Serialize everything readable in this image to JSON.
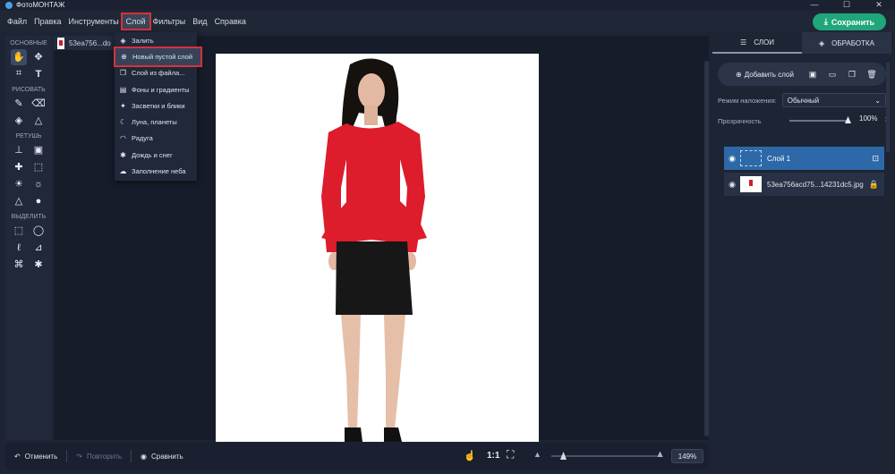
{
  "window": {
    "title": "ФотоМОНТАЖ",
    "minimize": "—",
    "maximize": "☐",
    "close": "✕"
  },
  "menu": [
    "Файл",
    "Правка",
    "Инструменты",
    "Слой",
    "Фильтры",
    "Вид",
    "Справка"
  ],
  "save_button": "Сохранить",
  "toolbar": {
    "groups": [
      "ОСНОВНЫЕ",
      "РИСОВАТЬ",
      "РЕТУШЬ",
      "ВЫДЕЛИТЬ"
    ]
  },
  "document_tab": "53ea756...do",
  "layer_menu": [
    {
      "label": "Залить",
      "icon": "fill-icon"
    },
    {
      "label": "Новый пустой слой",
      "icon": "add-circle-icon"
    },
    {
      "label": "Слой из файла...",
      "icon": "file-layer-icon"
    },
    {
      "label": "Фоны и градиенты",
      "icon": "background-icon"
    },
    {
      "label": "Засветки и блики",
      "icon": "sparkle-icon"
    },
    {
      "label": "Луна, планеты",
      "icon": "moon-icon"
    },
    {
      "label": "Радуга",
      "icon": "rainbow-icon"
    },
    {
      "label": "Дождь и снег",
      "icon": "snow-icon"
    },
    {
      "label": "Заполнение неба",
      "icon": "cloud-icon"
    }
  ],
  "bottom": {
    "undo": "Отменить",
    "redo": "Повторить",
    "compare": "Сравнить",
    "ratio": "1:1",
    "zoom": "149%",
    "zoom_level": 0.1
  },
  "right_panel": {
    "tab_layers": "СЛОИ",
    "tab_processing": "ОБРАБОТКА",
    "add_layer": "Добавить слой",
    "blend_label": "Режим наложения:",
    "blend_value": "Обычный",
    "opacity_label": "Прозрачность",
    "opacity_value": "100%",
    "layers": [
      {
        "name": "Слой 1",
        "selected": true
      },
      {
        "name": "53ea756acd75...14231dc5.jpg",
        "selected": false
      }
    ]
  },
  "colors": {
    "accent_red": "#d9313a",
    "save_green": "#1fa779",
    "layer_selected": "#2d69a8"
  }
}
